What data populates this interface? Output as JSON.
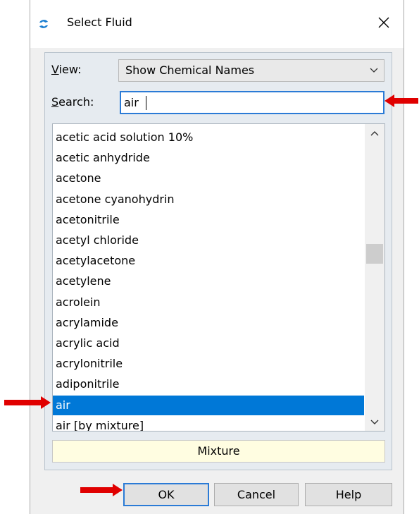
{
  "window": {
    "title": "Select Fluid"
  },
  "filters": {
    "view_label": "View:",
    "view_value": "Show Chemical Names",
    "search_label": "Search:",
    "search_value": "air"
  },
  "fluids": [
    "acetic acid solution 10%",
    "acetic anhydride",
    "acetone",
    "acetone cyanohydrin",
    "acetonitrile",
    "acetyl chloride",
    "acetylacetone",
    "acetylene",
    "acrolein",
    "acrylamide",
    "acrylic acid",
    "acrylonitrile",
    "adiponitrile",
    "air",
    "air [by mixture]"
  ],
  "selected_fluid": "air",
  "buttons": {
    "mixture": "Mixture",
    "ok": "OK",
    "cancel": "Cancel",
    "help": "Help"
  },
  "colors": {
    "selection": "#0078d7",
    "focus_border": "#2b7bd6",
    "annotation_arrow": "#e00000",
    "mixture_bg": "#fffde1"
  },
  "icons": [
    "app-icon",
    "close-icon",
    "chevron-down-icon",
    "scroll-up-icon",
    "scroll-down-icon",
    "red-arrow-icon"
  ]
}
